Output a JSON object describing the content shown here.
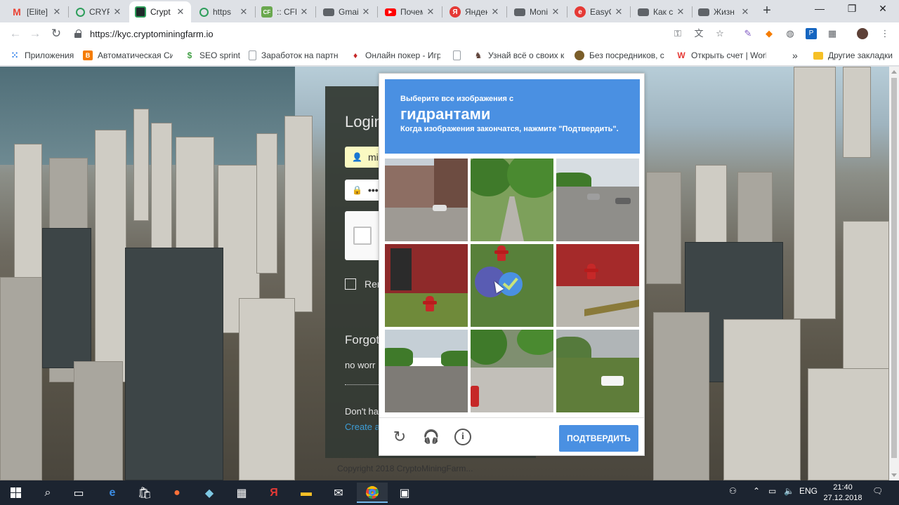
{
  "browser": {
    "tabs": [
      {
        "label": "[Elite]",
        "favicon_icon": "gmail-icon",
        "color": "#ea4335"
      },
      {
        "label": "CRYP",
        "favicon_icon": "crypto-icon",
        "color": "#2e9e5b"
      },
      {
        "label": "Crypt",
        "favicon_icon": "cryptominingfarm-icon",
        "color": "#1f2a2a",
        "active": true
      },
      {
        "label": "https",
        "favicon_icon": "crypto-icon",
        "color": "#2e9e5b"
      },
      {
        "label": ":: CFP",
        "favicon_icon": "cfpay-icon",
        "color": "#6aa84f"
      },
      {
        "label": "Gmail",
        "favicon_icon": "folder-icon",
        "color": "#5f6368"
      },
      {
        "label": "Почему",
        "favicon_icon": "youtube-icon",
        "color": "#ff0000"
      },
      {
        "label": "Яндекс",
        "favicon_icon": "yandex-icon",
        "color": "#e53935"
      },
      {
        "label": "Moni",
        "favicon_icon": "folder-icon",
        "color": "#5f6368"
      },
      {
        "label": "EasyC",
        "favicon_icon": "easy-icon",
        "color": "#e53935"
      },
      {
        "label": "Как с",
        "favicon_icon": "folder-icon",
        "color": "#5f6368"
      },
      {
        "label": "Жизн",
        "favicon_icon": "folder-icon",
        "color": "#5f6368"
      }
    ],
    "url": "https://kyc.cryptominingfarm.io",
    "bookmarks": [
      {
        "label": "Приложения",
        "icon": "apps-grid-icon",
        "color": "#1a73e8"
      },
      {
        "label": "Автоматическая Сис",
        "icon": "blogger-icon",
        "color": "#f57c00"
      },
      {
        "label": "SEO sprint",
        "icon": "seosprint-icon",
        "color": "#43a047"
      },
      {
        "label": "Заработок на партнё",
        "icon": "page-icon",
        "color": "#9aa0a6"
      },
      {
        "label": "Онлайн покер - Игр",
        "icon": "poker-icon",
        "color": "#c62828"
      },
      {
        "label": "",
        "icon": "page-icon",
        "color": "#9aa0a6"
      },
      {
        "label": "Узнай всё о своих кс",
        "icon": "chess-icon",
        "color": "#5d4037"
      },
      {
        "label": "Без посредников, са",
        "icon": "globe-icon",
        "color": "#7b5e2a"
      },
      {
        "label": "Открыть счет | Worl",
        "icon": "w-icon",
        "color": "#e53935"
      }
    ],
    "other_bookmarks": "Другие закладки",
    "more_bookmarks": "»"
  },
  "page": {
    "login": {
      "title": "Login",
      "username_value": "mi",
      "password_value": "•••",
      "remember_label": "Rem",
      "forgot_title": "Forgot",
      "no_worries": "no worr",
      "dont_have": "Don't ha",
      "create_link": "Create a"
    },
    "copyright": "Copyright 2018 CryptoMiningFarm..."
  },
  "captcha": {
    "instruction_pre": "Выберите все изображения с",
    "object": "гидрантами",
    "instruction_post": "Когда изображения закончатся, нажмите \"Подтвердить\".",
    "verify_label": "ПОДТВЕРДИТЬ",
    "tiles": [
      {
        "id": 1,
        "scene": "street-buildings",
        "selected": false
      },
      {
        "id": 2,
        "scene": "path-trees",
        "selected": false
      },
      {
        "id": 3,
        "scene": "highway-cars",
        "selected": false
      },
      {
        "id": 4,
        "scene": "hydrant-wall-bike",
        "selected": false
      },
      {
        "id": 5,
        "scene": "hydrant-grass",
        "selected": true
      },
      {
        "id": 6,
        "scene": "hydrant-sidewalk",
        "selected": false
      },
      {
        "id": 7,
        "scene": "road-empty",
        "selected": false
      },
      {
        "id": 8,
        "scene": "road-trees",
        "selected": false
      },
      {
        "id": 9,
        "scene": "field-car",
        "selected": false
      }
    ],
    "accent_color": "#4a90e2"
  },
  "taskbar": {
    "language": "ENG",
    "time": "21:40",
    "date": "27.12.2018"
  }
}
